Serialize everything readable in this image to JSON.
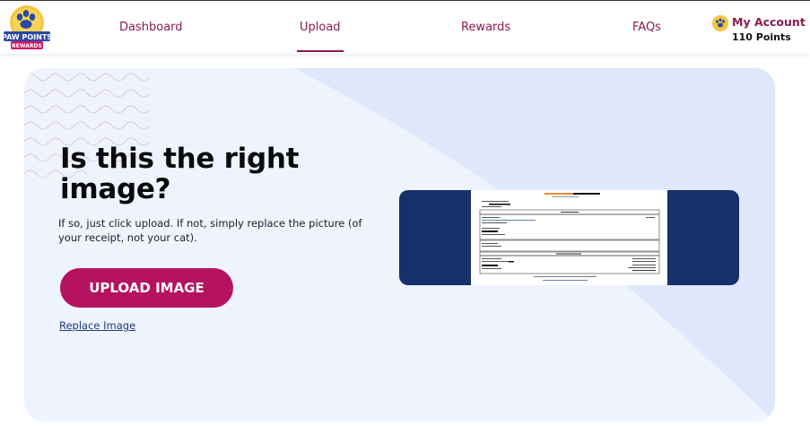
{
  "nav": {
    "brand_line1": "PAW POINTS",
    "brand_line2": "REWARDS",
    "links": [
      "Dashboard",
      "Upload",
      "Rewards",
      "FAQs"
    ],
    "active": "Upload",
    "account_label": "My Account",
    "points": "110 Points"
  },
  "main": {
    "headline": "Is this the right image?",
    "subtext": "If so, just click upload. If not, simply replace the picture (of your receipt, not your cat).",
    "upload_label": "UPLOAD IMAGE",
    "replace_label": "Replace Image"
  },
  "colors": {
    "brand": "#8b1a52",
    "button": "#b5135f",
    "card_bg": "#eef3fe",
    "preview_bg": "#16306a",
    "link": "#1f3a78"
  },
  "icons": {
    "logo": "paw-points-logo",
    "account": "paw-icon"
  }
}
